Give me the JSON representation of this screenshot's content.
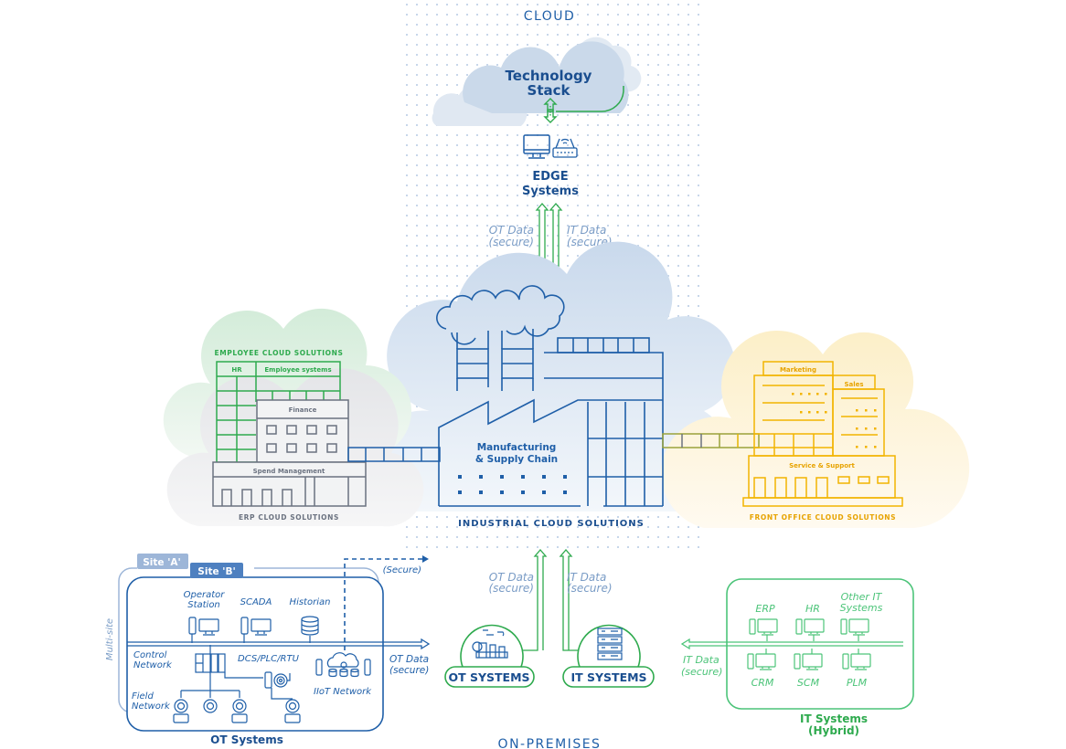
{
  "colors": {
    "navy": "#1f5fa8",
    "dark_navy": "#1a4e8f",
    "green": "#2eaa4e",
    "light_green": "#4cc479",
    "gray": "#6b7280",
    "yellow": "#f2b400",
    "orange_text": "#e7a300",
    "light_blue_text": "#7a9cc6",
    "cloud_blue": "#cddbeb",
    "cloud_light": "#e3ebf4",
    "green_cloud": "#d8eedc",
    "gray_cloud": "#ebecee",
    "yellow_cloud": "#fdf1cf"
  },
  "zones": {
    "cloud_label": "CLOUD",
    "on_premises_label": "ON-PREMISES"
  },
  "cloud": {
    "technology_stack": [
      "Technology",
      "Stack"
    ],
    "edge_systems": [
      "EDGE",
      "Systems"
    ],
    "ot_data_label": [
      "OT Data",
      "(secure)"
    ],
    "it_data_label": [
      "IT Data",
      "(secure)"
    ]
  },
  "industrial": {
    "building_label": [
      "Manufacturing",
      "& Supply Chain"
    ],
    "caption": "INDUSTRIAL CLOUD SOLUTIONS"
  },
  "erp": {
    "employee_caption": "EMPLOYEE CLOUD SOLUTIONS",
    "hr_label": "HR",
    "employee_systems_label": "Employee systems",
    "finance_label": "Finance",
    "spend_label": "Spend Management",
    "caption": "ERP CLOUD SOLUTIONS"
  },
  "front_office": {
    "marketing_label": "Marketing",
    "sales_label": "Sales",
    "service_label": "Service & Support",
    "caption": "FRONT OFFICE CLOUD SOLUTIONS"
  },
  "on_prem": {
    "ot_data_label": [
      "OT Data",
      "(secure)"
    ],
    "it_data_label": [
      "IT Data",
      "(secure)"
    ],
    "ot_systems_badge": "OT SYSTEMS",
    "it_systems_badge": "IT SYSTEMS"
  },
  "ot_panel": {
    "site_a": "Site 'A'",
    "site_b": "Site 'B'",
    "multi_site": "Multi-site",
    "secure_label": "(Secure)",
    "operator_station": [
      "Operator",
      "Station"
    ],
    "scada": "SCADA",
    "historian": "Historian",
    "control_network": [
      "Control",
      "Network"
    ],
    "dcs": "DCS/PLC/RTU",
    "field_network": [
      "Field",
      "Network"
    ],
    "iiot_network": "IIoT Network",
    "ot_data_out": [
      "OT Data",
      "(secure)"
    ],
    "title": "OT Systems"
  },
  "it_panel": {
    "top_items": [
      "ERP",
      "HR",
      "Other IT"
    ],
    "other_it_line2": "Systems",
    "bottom_items": [
      "CRM",
      "SCM",
      "PLM"
    ],
    "it_data_out": [
      "IT Data",
      "(secure)"
    ],
    "title": [
      "IT Systems",
      "(Hybrid)"
    ]
  }
}
